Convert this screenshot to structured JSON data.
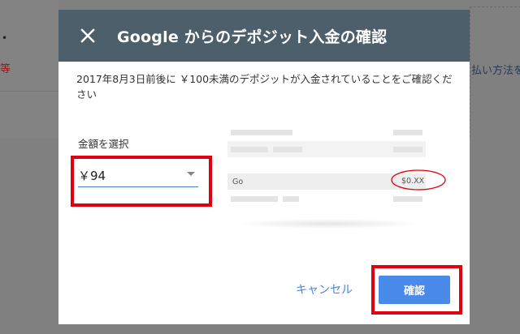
{
  "dialog": {
    "title": "Google からのデポジット入金の確認",
    "description": "2017年8月3日前後に ￥100未満のデポジットが入金されていることをご確認ください",
    "amount_label": "金額を選択",
    "amount_value": "￥94",
    "statement_sample": {
      "merchant": "Go",
      "amount": "$0.XX"
    },
    "cancel_label": "キャンセル",
    "confirm_label": "確認"
  },
  "background": {
    "right_text": "払い方法を",
    "left_text": "等"
  },
  "colors": {
    "header": "#4c5f6b",
    "accent": "#4a8ae8",
    "highlight": "#e0000f"
  },
  "icons": [
    "close-icon",
    "dropdown-arrow-icon"
  ]
}
